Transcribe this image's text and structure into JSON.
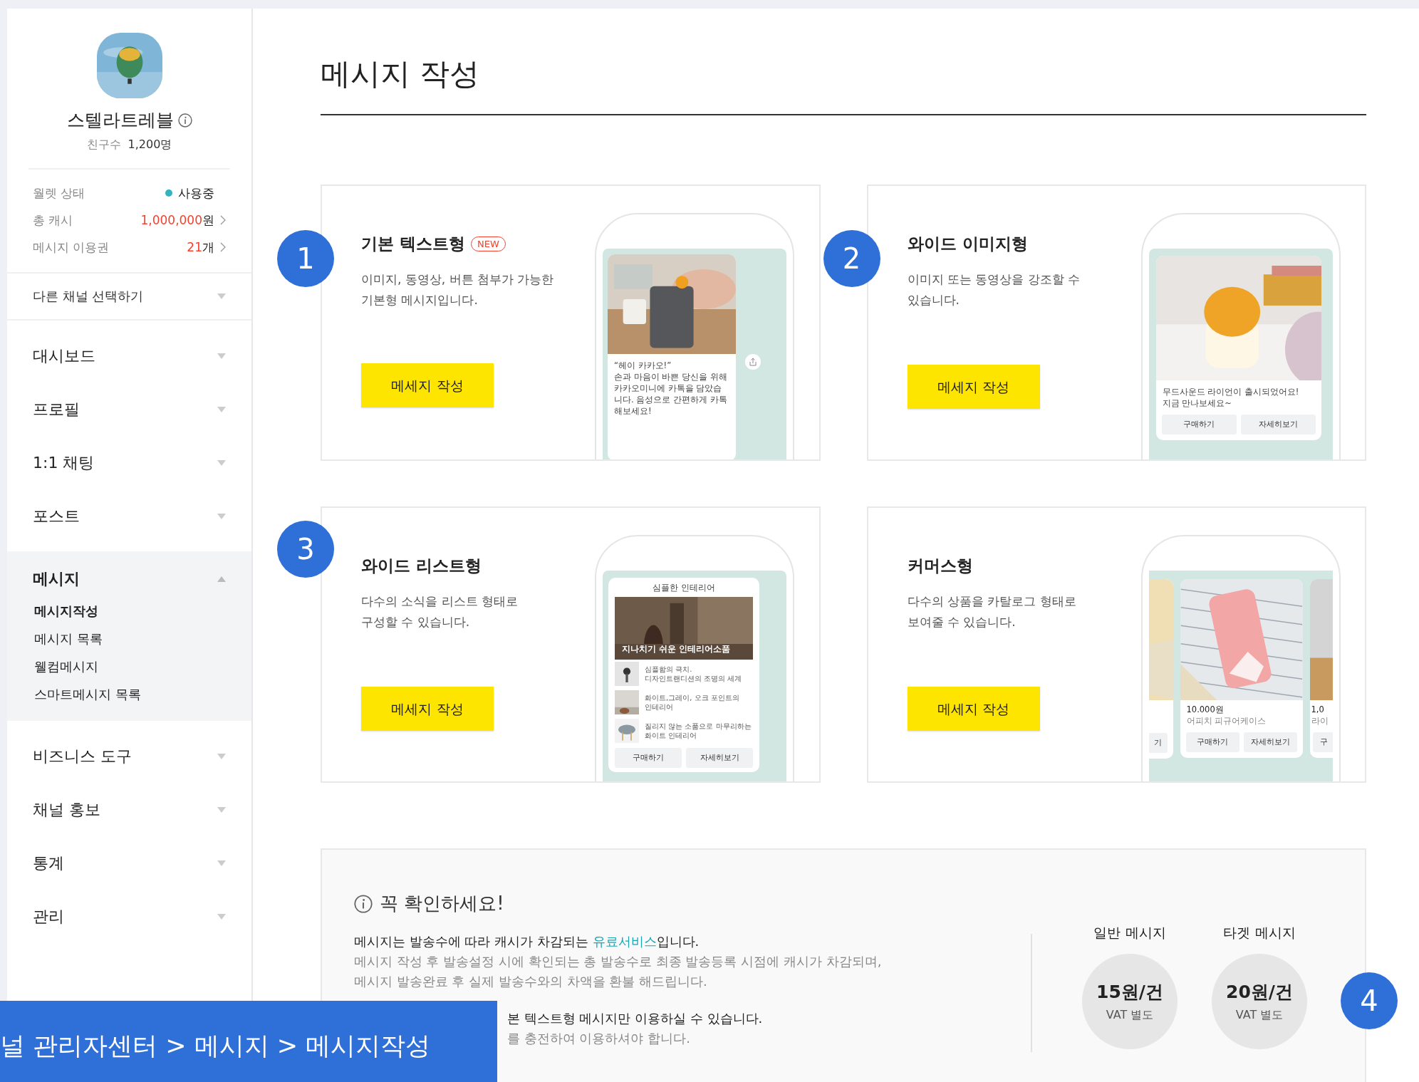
{
  "sidebar": {
    "profile": {
      "name": "스텔라트레블",
      "friends_label": "친구수",
      "friends_count": "1,200명"
    },
    "wallet": [
      {
        "kind": "status",
        "label": "월렛 상태",
        "value": "사용중",
        "color": "#2fb4c0"
      },
      {
        "kind": "link",
        "label": "총 캐시",
        "amount": "1,000,000",
        "unit": "원"
      },
      {
        "kind": "link",
        "label": "메시지 이용권",
        "amount": "21",
        "unit": "개"
      }
    ],
    "channel_select": "다른 채널 선택하기",
    "menu": [
      {
        "label": "대시보드",
        "expanded": false
      },
      {
        "label": "프로필",
        "expanded": false
      },
      {
        "label": "1:1 채팅",
        "expanded": false
      },
      {
        "label": "포스트",
        "expanded": false
      },
      {
        "label": "메시지",
        "expanded": true,
        "children": [
          {
            "label": "메시지작성",
            "selected": true
          },
          {
            "label": "메시지 목록",
            "selected": false
          },
          {
            "label": "웰컴메시지",
            "selected": false
          },
          {
            "label": "스마트메시지 목록",
            "selected": false
          }
        ]
      },
      {
        "label": "비즈니스 도구",
        "expanded": false
      },
      {
        "label": "채널 홍보",
        "expanded": false
      },
      {
        "label": "통계",
        "expanded": false
      },
      {
        "label": "관리",
        "expanded": false
      }
    ]
  },
  "page_title": "메시지 작성",
  "cards": [
    {
      "number": "1",
      "title": "기본 텍스트형",
      "badge": "NEW",
      "description": [
        "이미지, 동영상, 버튼 첨부가 가능한",
        "기본형 메시지입니다."
      ],
      "button": "메세지 작성",
      "preview": {
        "kind": "text",
        "quote": "“헤이 카카오!”",
        "body": "손과 마음이 바쁜 당신을 위해 카카오미니에 카톡을 담았습니다. 음성으로 간편하게 카톡해보세요!"
      }
    },
    {
      "number": "2",
      "title": "와이드 이미지형",
      "description": [
        "이미지 또는 동영상을 강조할 수",
        "있습니다."
      ],
      "button": "메세지 작성",
      "preview": {
        "kind": "wide_image",
        "lines": [
          "무드사운드 라이언이 출시되었어요!",
          "지금 만나보세요~"
        ],
        "buttons": [
          "구매하기",
          "자세히보기"
        ]
      }
    },
    {
      "number": "3",
      "title": "와이드 리스트형",
      "description": [
        "다수의 소식을 리스트 형태로",
        "구성할 수 있습니다."
      ],
      "button": "메세지 작성",
      "preview": {
        "kind": "list",
        "header": "심플한 인테리어",
        "hero_caption": "지나치기 쉬운 인테리어소품",
        "items": [
          [
            "심플함의 극치.",
            "디자인트랜디션의 조명의 세계"
          ],
          [
            "화이트,그레이, 오크 포인트의",
            "인테리어"
          ],
          [
            "질리지 않는 소품으로 마무리하는",
            "화이트 인테리어"
          ]
        ],
        "buttons": [
          "구매하기",
          "자세히보기"
        ]
      }
    },
    {
      "title": "커머스형",
      "description": [
        "다수의 상품을 카탈로그 형태로",
        "보여줄 수 있습니다."
      ],
      "button": "메세지 작성",
      "preview": {
        "kind": "commerce",
        "left_button": "기",
        "product": {
          "price": "10.000원",
          "name": "어피치 피규어케이스",
          "buttons": [
            "구매하기",
            "자세히보기"
          ]
        },
        "right": {
          "price": "1,0",
          "name": "라이",
          "button": "구"
        }
      }
    }
  ],
  "notice": {
    "title": "꼭 확인하세요!",
    "lead_before": "메시지는 발송수에 따라 캐시가 차감되는 ",
    "link": "유료서비스",
    "lead_after": "입니다.",
    "details": [
      "메시지 작성 후 발송설정 시에 확인되는 총 발송수로 최종 발송등록 시점에 캐시가 차감되며,",
      "메시지 발송완료 후 실제 발송수와의 차액을 환불 해드립니다."
    ],
    "partial_lead": "본 텍스트형 메시지만 이용하실 수 있습니다.",
    "partial_detail": "를 충전하여 이용하셔야 합니다.",
    "prices": [
      {
        "label": "일반 메시지",
        "price": "15원/건",
        "vat": "VAT 별도"
      },
      {
        "label": "타겟 메시지",
        "price": "20원/건",
        "vat": "VAT 별도"
      }
    ],
    "number": "4"
  },
  "breadcrumb": "널 관리자센터 > 메시지 > 메시지작성"
}
